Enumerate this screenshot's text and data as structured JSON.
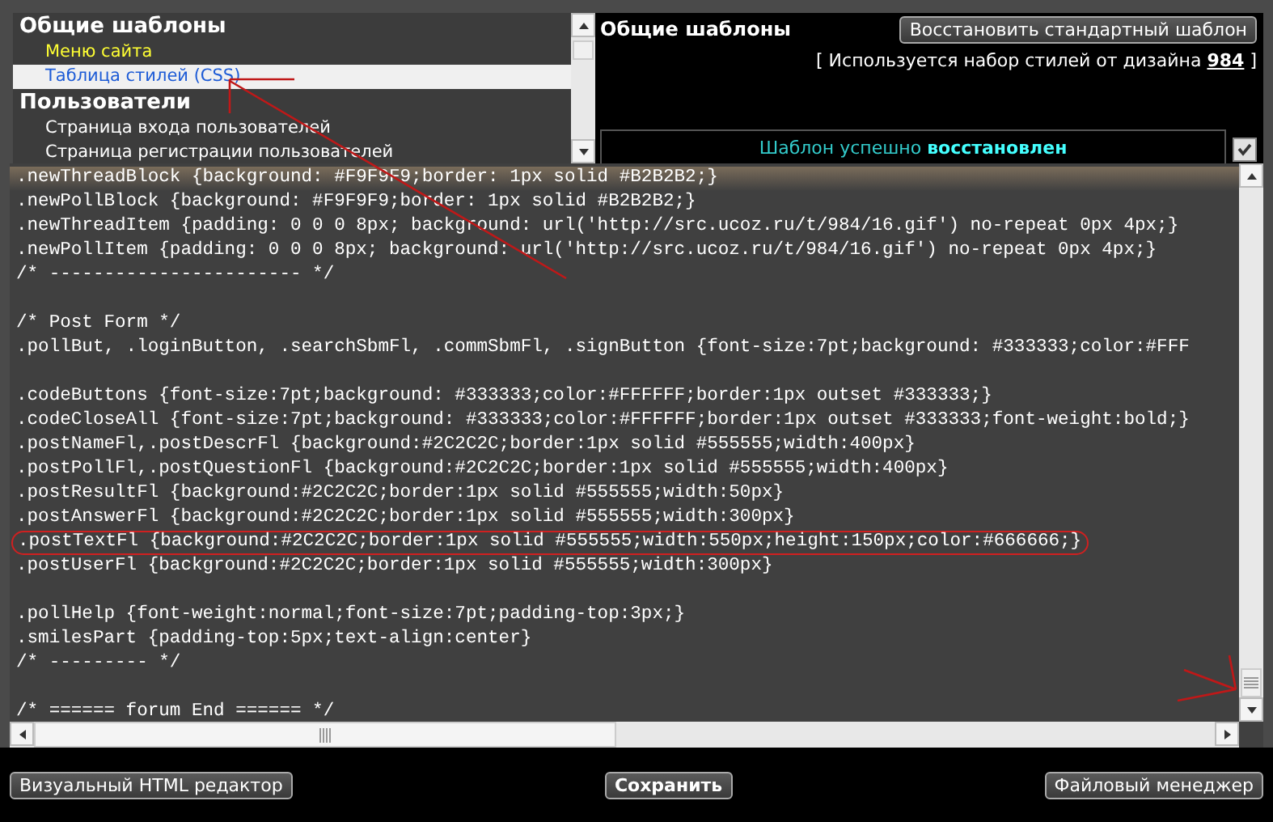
{
  "template_tree": [
    {
      "title": "Общие шаблоны",
      "items": [
        {
          "label": "Меню сайта",
          "highlighted": true,
          "selected": false
        },
        {
          "label": "Таблица стилей (CSS)",
          "highlighted": false,
          "selected": true
        }
      ]
    },
    {
      "title": "Пользователи",
      "items": [
        {
          "label": "Страница входа пользователей",
          "highlighted": false,
          "selected": false
        },
        {
          "label": "Страница регистрации пользователей",
          "highlighted": false,
          "selected": false
        }
      ]
    }
  ],
  "header": {
    "title": "Общие шаблоны",
    "restore_button": "Восстановить стандартный шаблон",
    "style_note": "[ Используется набор стилей от дизайна ",
    "design_link": "984",
    "style_note_end": " ]",
    "status_message": "Шаблон успешно **восстановлен**",
    "status_checked": true
  },
  "code_lines": [
    {
      "kind": "code",
      "text": ".newThreadBlock {background: #F9F9F9;border: 1px solid #B2B2B2;}",
      "current": true,
      "circled": false
    },
    {
      "kind": "code",
      "text": ".newPollBlock {background: #F9F9F9;border: 1px solid #B2B2B2;}",
      "current": false,
      "circled": false
    },
    {
      "kind": "code",
      "text": ".newThreadItem {padding: 0 0 0 8px; background: url('http://src.ucoz.ru/t/984/16.gif') no-repeat 0px 4px;}",
      "current": false,
      "circled": false
    },
    {
      "kind": "code",
      "text": ".newPollItem {padding: 0 0 0 8px; background: url('http://src.ucoz.ru/t/984/16.gif') no-repeat 0px 4px;}",
      "current": false,
      "circled": false
    },
    {
      "kind": "code",
      "text": "/* ----------------------- */",
      "current": false,
      "circled": false
    },
    {
      "kind": "blank"
    },
    {
      "kind": "code",
      "text": "/* Post Form */",
      "current": false,
      "circled": false
    },
    {
      "kind": "code",
      "text": ".pollBut, .loginButton, .searchSbmFl, .commSbmFl, .signButton {font-size:7pt;background: #333333;color:#FFF",
      "current": false,
      "circled": false
    },
    {
      "kind": "blank"
    },
    {
      "kind": "code",
      "text": ".codeButtons {font-size:7pt;background: #333333;color:#FFFFFF;border:1px outset #333333;}",
      "current": false,
      "circled": false
    },
    {
      "kind": "code",
      "text": ".codeCloseAll {font-size:7pt;background: #333333;color:#FFFFFF;border:1px outset #333333;font-weight:bold;}",
      "current": false,
      "circled": false
    },
    {
      "kind": "code",
      "text": ".postNameFl,.postDescrFl {background:#2C2C2C;border:1px solid #555555;width:400px}",
      "current": false,
      "circled": false
    },
    {
      "kind": "code",
      "text": ".postPollFl,.postQuestionFl {background:#2C2C2C;border:1px solid #555555;width:400px}",
      "current": false,
      "circled": false
    },
    {
      "kind": "code",
      "text": ".postResultFl {background:#2C2C2C;border:1px solid #555555;width:50px}",
      "current": false,
      "circled": false
    },
    {
      "kind": "code",
      "text": ".postAnswerFl {background:#2C2C2C;border:1px solid #555555;width:300px}",
      "current": false,
      "circled": false
    },
    {
      "kind": "code",
      "text": ".postTextFl {background:#2C2C2C;border:1px solid #555555;width:550px;height:150px;color:#666666;}",
      "current": false,
      "circled": true
    },
    {
      "kind": "code",
      "text": ".postUserFl {background:#2C2C2C;border:1px solid #555555;width:300px}",
      "current": false,
      "circled": false
    },
    {
      "kind": "blank"
    },
    {
      "kind": "code",
      "text": ".pollHelp {font-weight:normal;font-size:7pt;padding-top:3px;}",
      "current": false,
      "circled": false
    },
    {
      "kind": "code",
      "text": ".smilesPart {padding-top:5px;text-align:center}",
      "current": false,
      "circled": false
    },
    {
      "kind": "code",
      "text": "/* --------- */",
      "current": false,
      "circled": false
    },
    {
      "kind": "blank"
    },
    {
      "kind": "code",
      "text": "/* ====== forum End ====== */",
      "current": false,
      "circled": false
    }
  ],
  "footer": {
    "visual_editor_button": "Визуальный HTML редактор",
    "save_button": "Сохранить",
    "file_manager_button": "Файловый менеджер"
  }
}
